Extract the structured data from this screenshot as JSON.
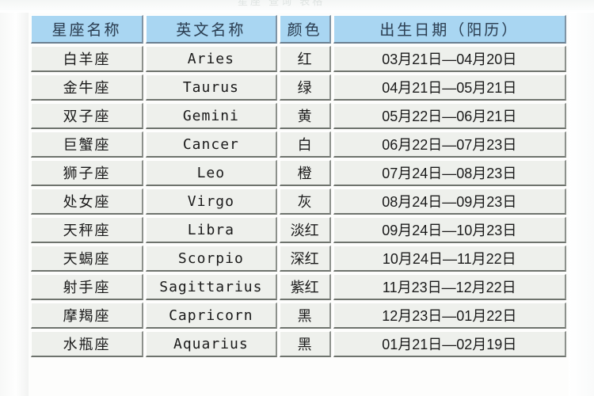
{
  "page": {
    "top_remnant_text": "星座 查询 表格",
    "background_color": "#fdfdfc",
    "header_background_color": "#a9d6f2",
    "cell_background_color": "#eef0ec"
  },
  "table": {
    "columns": [
      {
        "key": "cn_name",
        "label": "星座名称"
      },
      {
        "key": "en_name",
        "label": "英文名称"
      },
      {
        "key": "color",
        "label": "颜色"
      },
      {
        "key": "date",
        "label": "出生日期（阳历）"
      }
    ],
    "rows": [
      {
        "cn_name": "白羊座",
        "en_name": "Aries",
        "color": "红",
        "date": "03月21日—04月20日"
      },
      {
        "cn_name": "金牛座",
        "en_name": "Taurus",
        "color": "绿",
        "date": "04月21日—05月21日"
      },
      {
        "cn_name": "双子座",
        "en_name": "Gemini",
        "color": "黄",
        "date": "05月22日—06月21日"
      },
      {
        "cn_name": "巨蟹座",
        "en_name": "Cancer",
        "color": "白",
        "date": "06月22日—07月23日"
      },
      {
        "cn_name": "狮子座",
        "en_name": "Leo",
        "color": "橙",
        "date": "07月24日—08月23日"
      },
      {
        "cn_name": "处女座",
        "en_name": "Virgo",
        "color": "灰",
        "date": "08月24日—09月23日"
      },
      {
        "cn_name": "天秤座",
        "en_name": "Libra",
        "color": "淡红",
        "date": "09月24日—10月23日"
      },
      {
        "cn_name": "天蝎座",
        "en_name": "Scorpio",
        "color": "深红",
        "date": "10月24日—11月22日"
      },
      {
        "cn_name": "射手座",
        "en_name": "Sagittarius",
        "color": "紫红",
        "date": "11月23日—12月22日"
      },
      {
        "cn_name": "摩羯座",
        "en_name": "Capricorn",
        "color": "黑",
        "date": "12月23日—01月22日"
      },
      {
        "cn_name": "水瓶座",
        "en_name": "Aquarius",
        "color": "黑",
        "date": "01月21日—02月19日"
      }
    ]
  }
}
